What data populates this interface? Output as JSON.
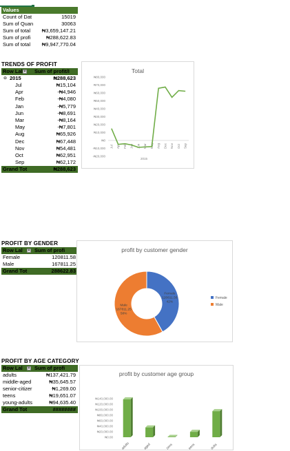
{
  "values_section": {
    "header": "Values",
    "rows": [
      {
        "label": "Count of Dat",
        "value": "15019"
      },
      {
        "label": "Sum of Quan",
        "value": "30063"
      },
      {
        "label": "Sum of total",
        "value": "₦3,659,147.21"
      },
      {
        "label": "Sum of profi",
        "value": "₦288,622.83"
      },
      {
        "label": "Sum of total",
        "value": "₦9,947,770.04"
      }
    ]
  },
  "trends": {
    "title": "TRENDS OF PROFIT",
    "col1": "Row Lal",
    "col2": "Sum of profit/I",
    "year_label": "2015",
    "year_value": "₦288,623",
    "rows": [
      {
        "label": "Jul",
        "value": "₦15,104"
      },
      {
        "label": "Apr",
        "value": "-₦4,946"
      },
      {
        "label": "Feb",
        "value": "-₦4,080"
      },
      {
        "label": "Jan",
        "value": "-₦5,779"
      },
      {
        "label": "Jun",
        "value": "-₦8,691"
      },
      {
        "label": "Mar",
        "value": "-₦8,164"
      },
      {
        "label": "May",
        "value": "-₦7,801"
      },
      {
        "label": "Aug",
        "value": "₦65,926"
      },
      {
        "label": "Dec",
        "value": "₦67,448"
      },
      {
        "label": "Nov",
        "value": "₦54,481"
      },
      {
        "label": "Oct",
        "value": "₦62,951"
      },
      {
        "label": "Sep",
        "value": "₦62,172"
      }
    ],
    "grand_label": "Grand Tot",
    "grand_value": "₦288,623"
  },
  "gender": {
    "title": "PROFIT BY GENDER",
    "col1": "Row Lal",
    "col2": "Sum of profi",
    "rows": [
      {
        "label": "Female",
        "value": "120811.58"
      },
      {
        "label": "Male",
        "value": "167811.25"
      }
    ],
    "grand_label": "Grand Tot",
    "grand_value": "288622.83"
  },
  "age": {
    "title": "PROFIT BY AGE CATEGORY",
    "col1": "Row Lal",
    "col2": "Sum of profi",
    "rows": [
      {
        "label": "adults",
        "value": "₦137,421.79"
      },
      {
        "label": "middle-aged",
        "value": "₦35,645.57"
      },
      {
        "label": "senior-citizer",
        "value": "₦1,269.00"
      },
      {
        "label": "teens",
        "value": "₦19,651.07"
      },
      {
        "label": "young-adults",
        "value": "₦94,635.40"
      }
    ],
    "grand_label": "Grand Tot",
    "grand_value": "########"
  },
  "chart_data": [
    {
      "type": "line",
      "title": "Total",
      "xlabel": "2015",
      "categories": [
        "Jul",
        "Apr",
        "Feb",
        "Jan",
        "Jun",
        "Mar",
        "May",
        "Aug",
        "Dec",
        "Nov",
        "Oct",
        "Sep"
      ],
      "values": [
        15104,
        -4946,
        -4080,
        -5779,
        -8691,
        -8164,
        -7801,
        65926,
        67448,
        54481,
        62951,
        62172
      ],
      "ylim": [
        -20000,
        80000
      ],
      "yticks": [
        "₦80,000",
        "₦70,000",
        "₦60,000",
        "₦50,000",
        "₦40,000",
        "₦30,000",
        "₦20,000",
        "₦10,000",
        "₦0",
        "-₦10,000",
        "-₦20,000"
      ],
      "color": "#70ad47"
    },
    {
      "type": "pie",
      "title": "profit by customer gender",
      "categories": [
        "Female",
        "Male"
      ],
      "values": [
        120811.58,
        167811.25
      ],
      "labels": [
        {
          "name": "Female",
          "value": "120811.58",
          "pct": "42%"
        },
        {
          "name": "Male",
          "value": "167811.25",
          "pct": "58%"
        }
      ],
      "colors": [
        "#4472c4",
        "#ed7d31"
      ],
      "legend": "right"
    },
    {
      "type": "bar",
      "title": "profit by customer age group",
      "categories": [
        "adults",
        "middle-aged",
        "senior-citizens",
        "teens",
        "young-adults"
      ],
      "tick_labels": [
        "adults",
        "aged",
        "zens",
        "eens",
        "dults"
      ],
      "values": [
        137421.79,
        35645.57,
        1269.0,
        19651.07,
        94635.4
      ],
      "ylim": [
        0,
        140000
      ],
      "yticks": [
        "₦140,000.00",
        "₦120,000.00",
        "₦100,000.00",
        "₦80,000.00",
        "₦60,000.00",
        "₦40,000.00",
        "₦20,000.00",
        "₦0.00"
      ],
      "color": "#70ad47"
    }
  ]
}
